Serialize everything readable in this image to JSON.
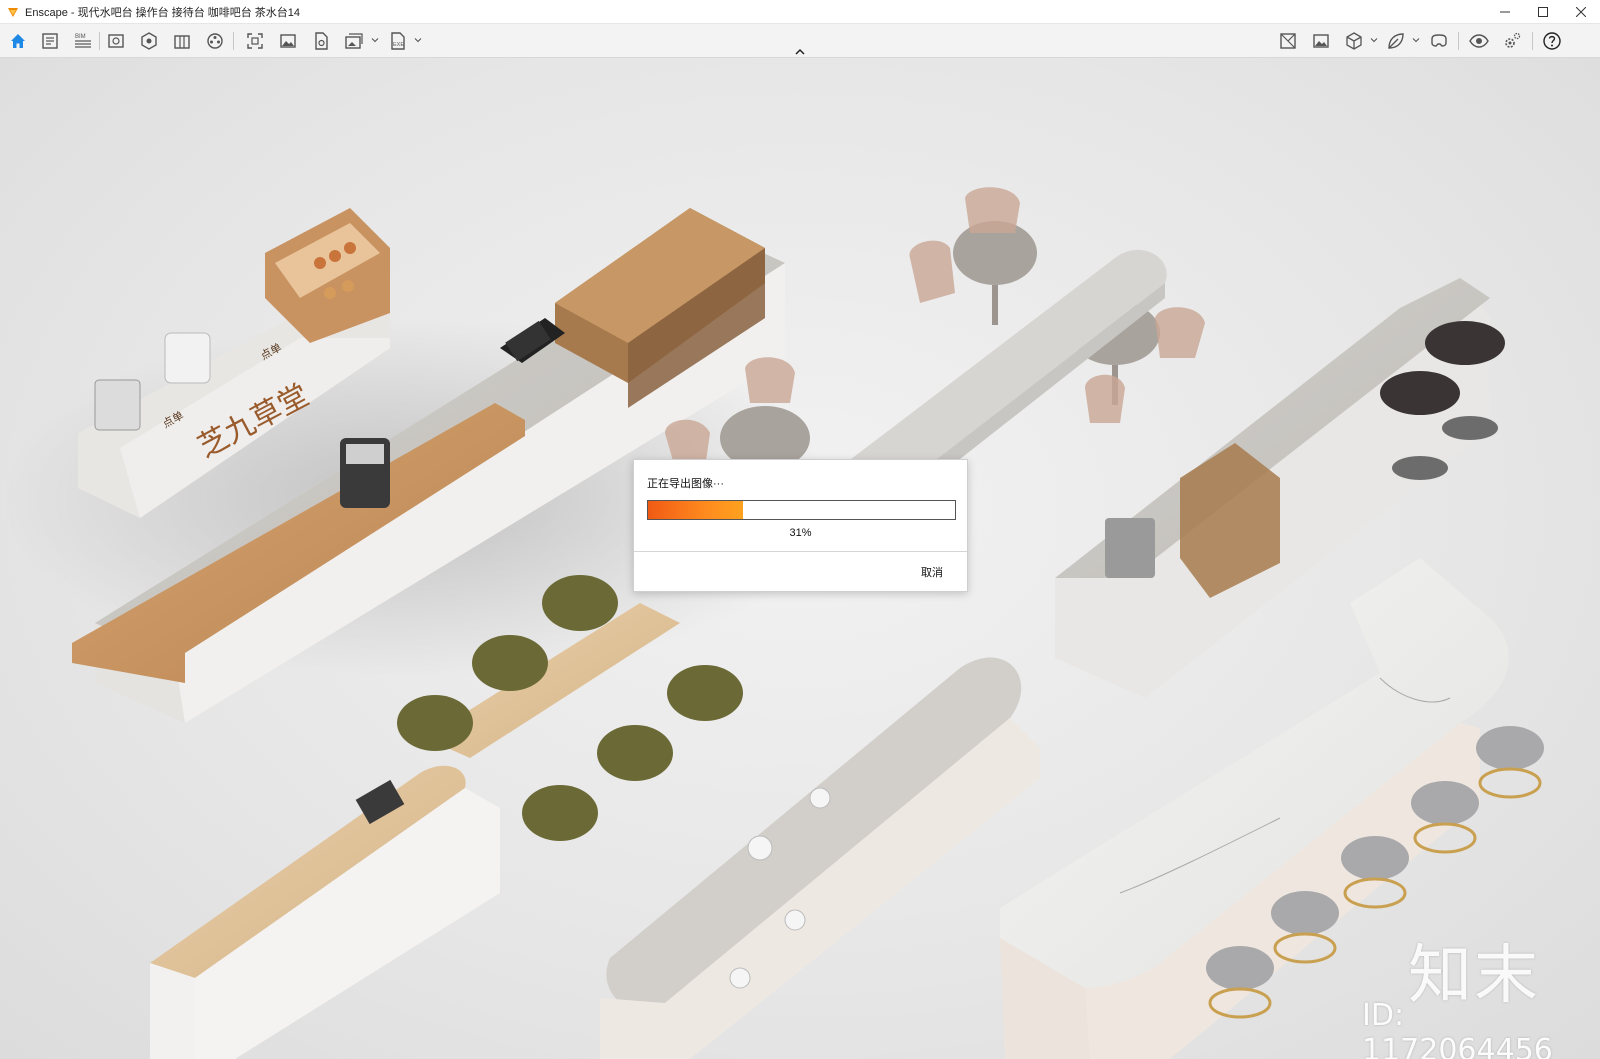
{
  "window": {
    "app_name": "Enscape",
    "title": "Enscape - 现代水吧台 操作台 接待台 咖啡吧台 茶水台14"
  },
  "toolbar": {
    "left_icons": [
      "home-icon",
      "document-icon",
      "bim-icon",
      "view-icon",
      "asset-library-icon",
      "building-icon",
      "materials-icon",
      "screenshot-icon",
      "image-icon",
      "export-file-icon",
      "batch-render-icon",
      "exe-export-icon"
    ],
    "right_icons": [
      "map-icon",
      "image-view-icon",
      "cube-icon",
      "leaf-icon",
      "vr-icon",
      "eye-icon",
      "settings-icon",
      "help-icon"
    ],
    "bim_label": "BIM",
    "exe_label": "EXE"
  },
  "dialog": {
    "message": "正在导出图像···",
    "progress_percent": 31,
    "progress_text": "31%",
    "cancel_label": "取消"
  },
  "watermark": {
    "logo_text": "知末",
    "id_text": "ID: 1172064456"
  },
  "scene": {
    "sign_text": "芝九草堂",
    "counter_label": "点单"
  }
}
